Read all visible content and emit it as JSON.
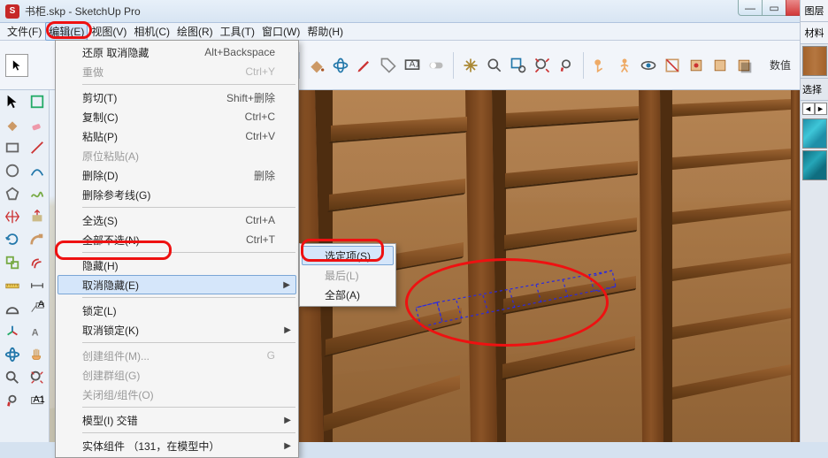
{
  "window": {
    "title": "书柜.skp - SketchUp Pro",
    "min": "—",
    "max": "▭",
    "close": "×"
  },
  "menubar": {
    "items": [
      {
        "label": "文件(F)"
      },
      {
        "label": "编辑(E)",
        "active": true
      },
      {
        "label": "视图(V)"
      },
      {
        "label": "相机(C)"
      },
      {
        "label": "绘图(R)"
      },
      {
        "label": "工具(T)"
      },
      {
        "label": "窗口(W)"
      },
      {
        "label": "帮助(H)"
      }
    ]
  },
  "top_toolbar": {
    "value_label": "数值"
  },
  "edit_menu": {
    "items": [
      {
        "label": "还原 取消隐藏",
        "shortcut": "Alt+Backspace"
      },
      {
        "label": "重做",
        "shortcut": "Ctrl+Y",
        "disabled": true
      },
      {
        "sep": true
      },
      {
        "label": "剪切(T)",
        "shortcut": "Shift+删除"
      },
      {
        "label": "复制(C)",
        "shortcut": "Ctrl+C"
      },
      {
        "label": "粘贴(P)",
        "shortcut": "Ctrl+V"
      },
      {
        "label": "原位粘贴(A)",
        "disabled": true
      },
      {
        "label": "删除(D)",
        "shortcut": "删除"
      },
      {
        "label": "删除参考线(G)"
      },
      {
        "sep": true
      },
      {
        "label": "全选(S)",
        "shortcut": "Ctrl+A"
      },
      {
        "label": "全部不选(N)",
        "shortcut": "Ctrl+T"
      },
      {
        "sep": true
      },
      {
        "label": "隐藏(H)"
      },
      {
        "label": "取消隐藏(E)",
        "submenu": true,
        "hot": true
      },
      {
        "sep": true
      },
      {
        "label": "锁定(L)"
      },
      {
        "label": "取消锁定(K)",
        "submenu": true
      },
      {
        "sep": true
      },
      {
        "label": "创建组件(M)...",
        "shortcut": "G",
        "disabled": true
      },
      {
        "label": "创建群组(G)",
        "disabled": true
      },
      {
        "label": "关闭组/组件(O)",
        "disabled": true
      },
      {
        "sep": true
      },
      {
        "label": "模型(I) 交错",
        "submenu": true
      },
      {
        "sep": true
      },
      {
        "label": "实体组件 （131，在模型中）",
        "submenu": true
      }
    ]
  },
  "unhide_submenu": {
    "items": [
      {
        "label": "选定项(S)",
        "hot": true
      },
      {
        "label": "最后(L)",
        "disabled": true
      },
      {
        "label": "全部(A)"
      }
    ]
  },
  "right_panels": {
    "layers_tab": "图层",
    "materials_tab": "材料",
    "select_label": "选择"
  }
}
